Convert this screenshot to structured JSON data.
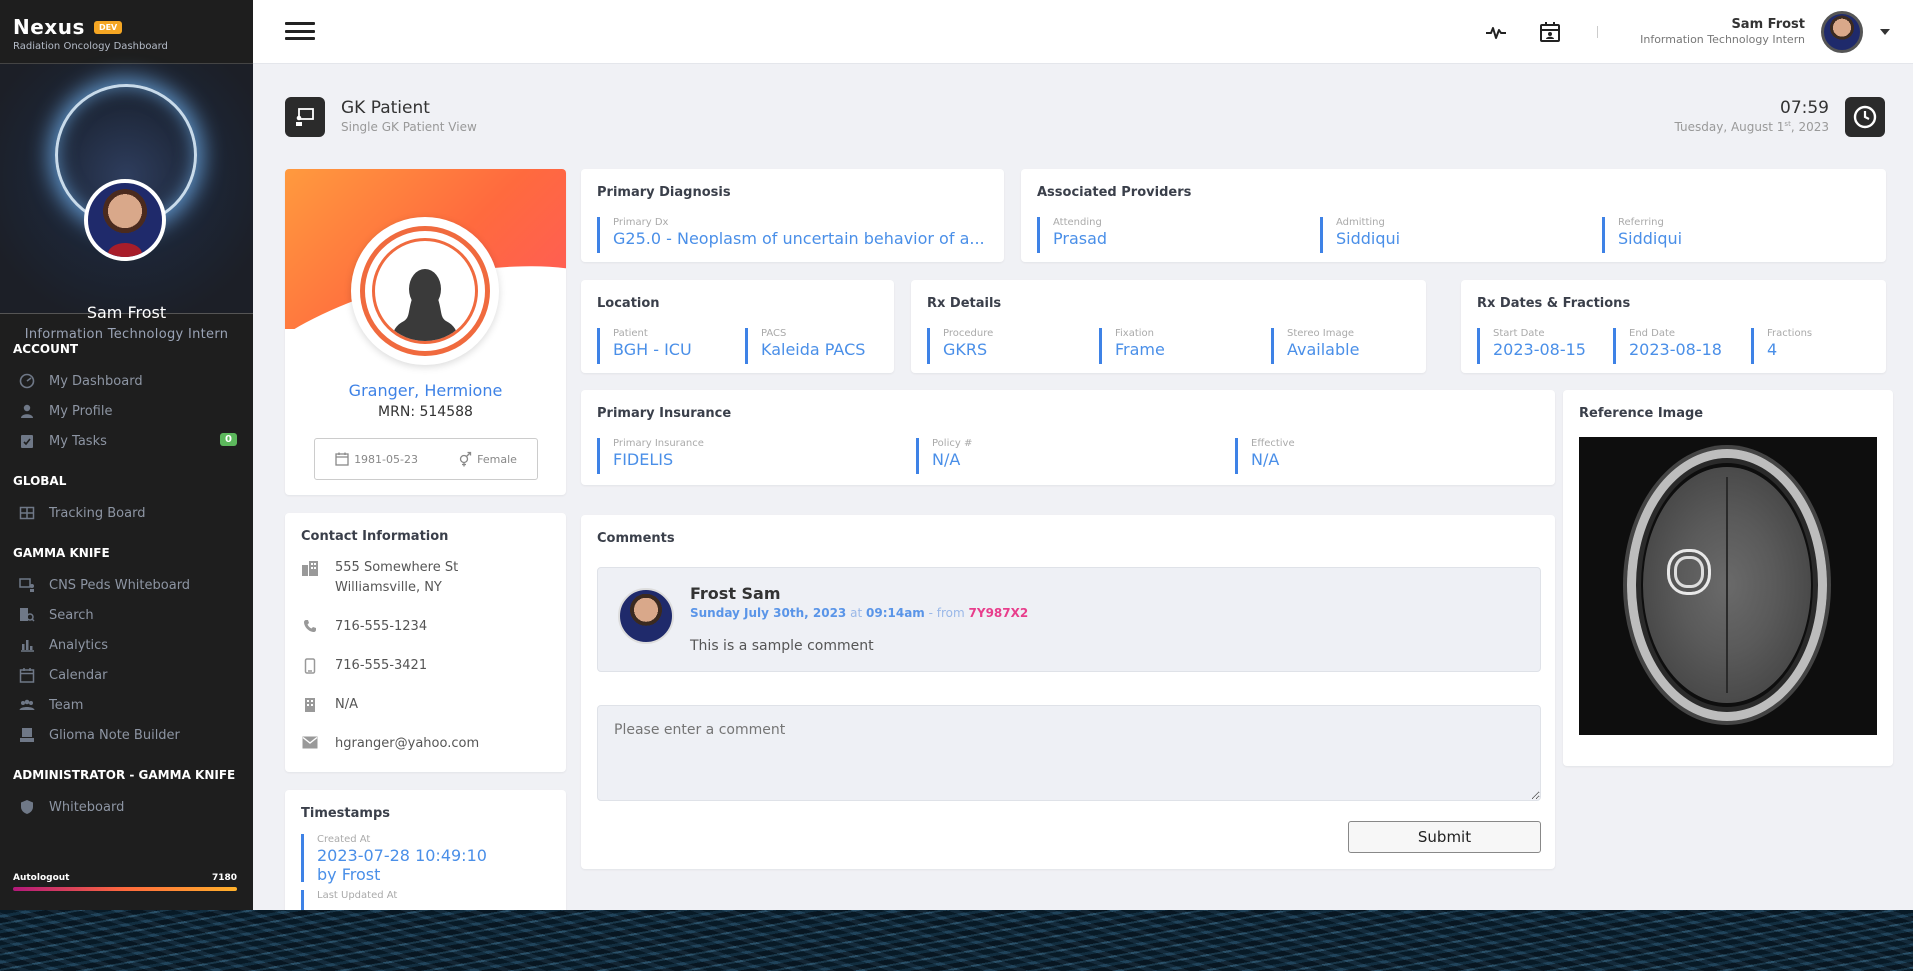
{
  "brand": {
    "name": "Nexus",
    "badge": "DEV",
    "subtitle": "Radiation Oncology Dashboard"
  },
  "sidebar_profile": {
    "name": "Sam Frost",
    "title": "Information Technology Intern"
  },
  "nav": {
    "account_head": "ACCOUNT",
    "account": [
      {
        "label": "My Dashboard",
        "icon": "dashboard-icon"
      },
      {
        "label": "My Profile",
        "icon": "person-icon"
      },
      {
        "label": "My Tasks",
        "icon": "tasks-icon",
        "badge": "0"
      }
    ],
    "global_head": "GLOBAL",
    "global": [
      {
        "label": "Tracking Board",
        "icon": "grid-icon"
      }
    ],
    "gk_head": "GAMMA KNIFE",
    "gk": [
      {
        "label": "CNS Peds Whiteboard",
        "icon": "whiteboard-icon"
      },
      {
        "label": "Search",
        "icon": "search-icon"
      },
      {
        "label": "Analytics",
        "icon": "analytics-icon"
      },
      {
        "label": "Calendar",
        "icon": "calendar-icon"
      },
      {
        "label": "Team",
        "icon": "team-icon"
      },
      {
        "label": "Glioma Note Builder",
        "icon": "note-icon"
      }
    ],
    "admin_head": "ADMINISTRATOR - GAMMA KNIFE",
    "admin": [
      {
        "label": "Whiteboard",
        "icon": "shield-icon"
      }
    ]
  },
  "autologout": {
    "label": "Autologout",
    "value": "7180"
  },
  "topbar": {
    "user_name": "Sam Frost",
    "user_title": "Information Technology Intern"
  },
  "page": {
    "title": "GK Patient",
    "subtitle": "Single GK Patient View",
    "time": "07:59",
    "date_main": "Tuesday, August 1",
    "date_sup": "st",
    "date_year": ", 2023"
  },
  "patient": {
    "name": "Granger, Hermione",
    "mrn": "MRN: 514588",
    "dob": "1981-05-23",
    "sex": "Female"
  },
  "contact": {
    "title": "Contact Information",
    "address1": "555 Somewhere St",
    "address2": "Williamsville, NY",
    "phone": "716-555-1234",
    "mobile": "716-555-3421",
    "fax": "N/A",
    "email": "hgranger@yahoo.com"
  },
  "timestamps": {
    "title": "Timestamps",
    "created_label": "Created At",
    "created_value": "2023-07-28 10:49:10",
    "created_by": "by Frost",
    "updated_label": "Last Updated At"
  },
  "diagnosis": {
    "title": "Primary Diagnosis",
    "label": "Primary Dx",
    "value": "G25.0 - Neoplasm of uncertain behavior of a..."
  },
  "providers": {
    "title": "Associated Providers",
    "attending_label": "Attending",
    "attending": "Prasad",
    "admitting_label": "Admitting",
    "admitting": "Siddiqui",
    "referring_label": "Referring",
    "referring": "Siddiqui"
  },
  "location": {
    "title": "Location",
    "patient_label": "Patient",
    "patient": "BGH - ICU",
    "pacs_label": "PACS",
    "pacs": "Kaleida PACS"
  },
  "rx": {
    "title": "Rx Details",
    "procedure_label": "Procedure",
    "procedure": "GKRS",
    "fixation_label": "Fixation",
    "fixation": "Frame",
    "stereo_label": "Stereo Image",
    "stereo": "Available"
  },
  "rx_dates": {
    "title": "Rx Dates & Fractions",
    "start_label": "Start Date",
    "start": "2023-08-15",
    "end_label": "End Date",
    "end": "2023-08-18",
    "fractions_label": "Fractions",
    "fractions": "4"
  },
  "insurance": {
    "title": "Primary Insurance",
    "ins_label": "Primary Insurance",
    "ins": "FIDELIS",
    "policy_label": "Policy #",
    "policy": "N/A",
    "effective_label": "Effective",
    "effective": "N/A"
  },
  "reference_image": {
    "title": "Reference Image"
  },
  "comments": {
    "title": "Comments",
    "items": [
      {
        "author": "Frost Sam",
        "date": "Sunday July 30th, 2023",
        "at": "at",
        "time": "09:14am",
        "from": "- from",
        "ip": "7Y987X2",
        "text": "This is a sample comment"
      }
    ],
    "placeholder": "Please enter a comment",
    "submit": "Submit"
  }
}
